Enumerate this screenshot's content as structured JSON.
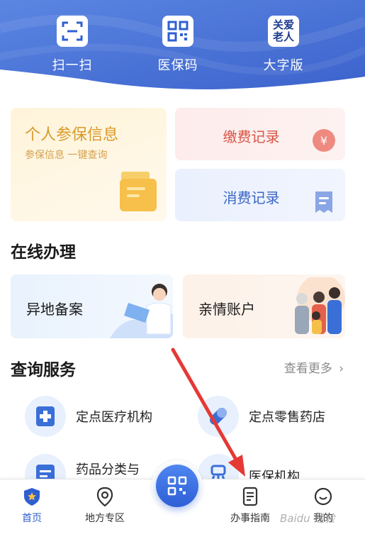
{
  "header": {
    "buttons": [
      {
        "label": "扫一扫",
        "icon": "scan-icon"
      },
      {
        "label": "医保码",
        "icon": "qr-code-icon"
      },
      {
        "label": "大字版",
        "icon": "elder-care-icon",
        "icon_text_1": "关爱",
        "icon_text_2": "老人"
      }
    ]
  },
  "cards": {
    "personal": {
      "title": "个人参保信息",
      "subtitle": "参保信息 一键查询"
    },
    "payment": {
      "title": "缴费记录"
    },
    "consumption": {
      "title": "消费记录"
    }
  },
  "online": {
    "title": "在线办理",
    "items": [
      {
        "label": "异地备案"
      },
      {
        "label": "亲情账户"
      }
    ]
  },
  "query": {
    "title": "查询服务",
    "more_label": "查看更多",
    "items": [
      {
        "label": "定点医疗机构"
      },
      {
        "label": "定点零售药店"
      },
      {
        "label": "药品分类与"
      },
      {
        "label": "医保机构"
      }
    ]
  },
  "tabbar": {
    "items": [
      {
        "label": "首页",
        "active": true
      },
      {
        "label": "地方专区"
      },
      {
        "label": "办事指南"
      },
      {
        "label": "我的"
      }
    ]
  },
  "colors": {
    "brand_blue": "#2f5fd0",
    "header_blue": "#4a73d6",
    "gold": "#d89a2a",
    "red": "#d95546",
    "annotation_arrow": "#e53935"
  },
  "watermark": "Baidu 经验"
}
